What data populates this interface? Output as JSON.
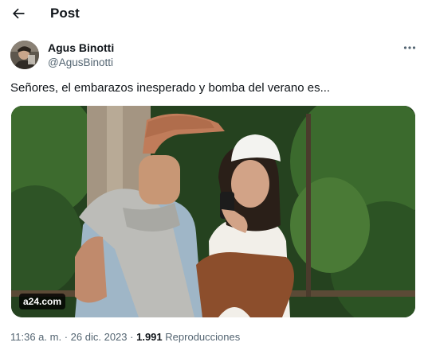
{
  "header": {
    "title": "Post"
  },
  "tweet": {
    "author_name": "Agus Binotti",
    "author_handle": "@AgusBinotti",
    "text": "Señores, el embarazos inesperado y bomba del verano es...",
    "media_source": "a24.com",
    "time": "11:36 a. m.",
    "separator": "·",
    "date": "26 dic. 2023",
    "views_count": "1.991",
    "views_label": "Reproducciones"
  },
  "icons": {
    "back": "arrow-left-icon",
    "more": "more-horizontal-icon"
  },
  "colors": {
    "text_primary": "#0f1419",
    "text_secondary": "#536471",
    "background": "#ffffff"
  }
}
